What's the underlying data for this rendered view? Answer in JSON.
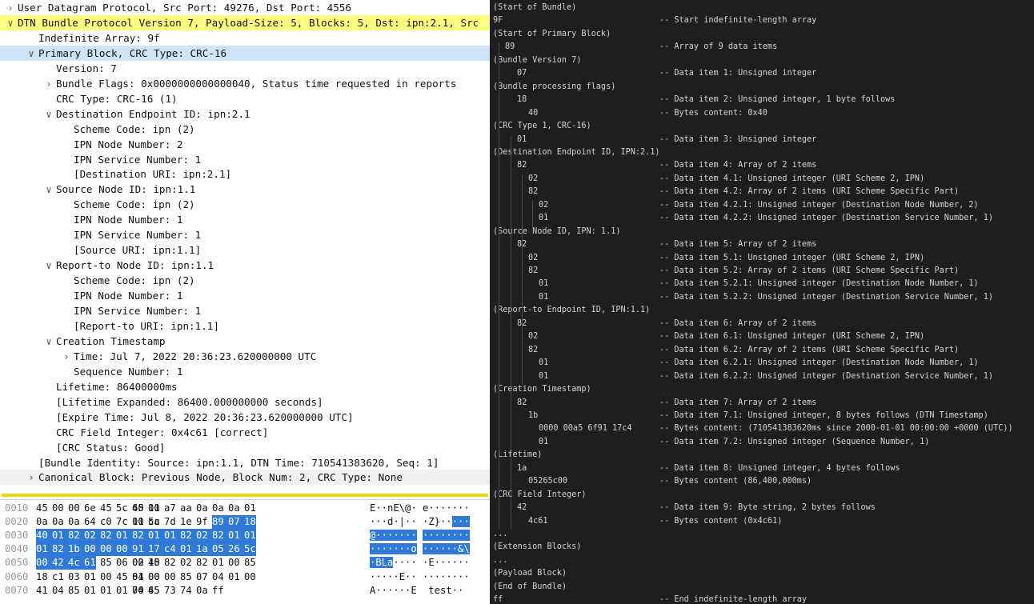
{
  "tree": [
    {
      "text": "User Datagram Protocol, Src Port: 49276, Dst Port: 4556",
      "indent": 0,
      "toggle": "right",
      "hl": ""
    },
    {
      "text": "DTN Bundle Protocol Version 7, Payload-Size: 5, Blocks: 5, Dst: ipn:2.1, Src",
      "indent": 0,
      "toggle": "down",
      "hl": "yellow"
    },
    {
      "text": "Indefinite Array: 9f",
      "indent": 1,
      "toggle": "",
      "hl": ""
    },
    {
      "text": "Primary Block, CRC Type: CRC-16",
      "indent": 1,
      "toggle": "down",
      "hl": "blue"
    },
    {
      "text": "Version: 7",
      "indent": 2,
      "toggle": "",
      "hl": ""
    },
    {
      "text": "Bundle Flags: 0x0000000000000040, Status time requested in reports",
      "indent": 2,
      "toggle": "right",
      "hl": ""
    },
    {
      "text": "CRC Type: CRC-16 (1)",
      "indent": 2,
      "toggle": "",
      "hl": ""
    },
    {
      "text": "Destination Endpoint ID: ipn:2.1",
      "indent": 2,
      "toggle": "down",
      "hl": ""
    },
    {
      "text": "Scheme Code: ipn (2)",
      "indent": 3,
      "toggle": "",
      "hl": ""
    },
    {
      "text": "IPN Node Number: 2",
      "indent": 3,
      "toggle": "",
      "hl": ""
    },
    {
      "text": "IPN Service Number: 1",
      "indent": 3,
      "toggle": "",
      "hl": ""
    },
    {
      "text": "[Destination URI: ipn:2.1]",
      "indent": 3,
      "toggle": "",
      "hl": ""
    },
    {
      "text": "Source Node ID: ipn:1.1",
      "indent": 2,
      "toggle": "down",
      "hl": ""
    },
    {
      "text": "Scheme Code: ipn (2)",
      "indent": 3,
      "toggle": "",
      "hl": ""
    },
    {
      "text": "IPN Node Number: 1",
      "indent": 3,
      "toggle": "",
      "hl": ""
    },
    {
      "text": "IPN Service Number: 1",
      "indent": 3,
      "toggle": "",
      "hl": ""
    },
    {
      "text": "[Source URI: ipn:1.1]",
      "indent": 3,
      "toggle": "",
      "hl": ""
    },
    {
      "text": "Report-to Node ID: ipn:1.1",
      "indent": 2,
      "toggle": "down",
      "hl": ""
    },
    {
      "text": "Scheme Code: ipn (2)",
      "indent": 3,
      "toggle": "",
      "hl": ""
    },
    {
      "text": "IPN Node Number: 1",
      "indent": 3,
      "toggle": "",
      "hl": ""
    },
    {
      "text": "IPN Service Number: 1",
      "indent": 3,
      "toggle": "",
      "hl": ""
    },
    {
      "text": "[Report-to URI: ipn:1.1]",
      "indent": 3,
      "toggle": "",
      "hl": ""
    },
    {
      "text": "Creation Timestamp",
      "indent": 2,
      "toggle": "down",
      "hl": ""
    },
    {
      "text": "Time: Jul  7, 2022 20:36:23.620000000 UTC",
      "indent": 3,
      "toggle": "right",
      "hl": ""
    },
    {
      "text": "Sequence Number: 1",
      "indent": 3,
      "toggle": "",
      "hl": ""
    },
    {
      "text": "Lifetime: 86400000ms",
      "indent": 2,
      "toggle": "",
      "hl": ""
    },
    {
      "text": "[Lifetime Expanded: 86400.000000000 seconds]",
      "indent": 2,
      "toggle": "",
      "hl": ""
    },
    {
      "text": "[Expire Time: Jul  8, 2022 20:36:23.620000000 UTC]",
      "indent": 2,
      "toggle": "",
      "hl": ""
    },
    {
      "text": "CRC Field Integer: 0x4c61 [correct]",
      "indent": 2,
      "toggle": "",
      "hl": ""
    },
    {
      "text": "[CRC Status: Good]",
      "indent": 2,
      "toggle": "",
      "hl": ""
    },
    {
      "text": "[Bundle Identity: Source: ipn:1.1, DTN Time: 710541383620, Seq: 1]",
      "indent": 1,
      "toggle": "",
      "hl": ""
    },
    {
      "text": "Canonical Block: Previous Node, Block Num: 2, CRC Type: None",
      "indent": 1,
      "toggle": "right",
      "hl": "grey"
    }
  ],
  "hex": [
    {
      "off": "0010",
      "b1": [
        "45",
        "00",
        "00",
        "6e",
        "45",
        "5c",
        "40",
        "00"
      ],
      "b2": [
        "65",
        "11",
        "a7",
        "aa",
        "0a",
        "0a",
        "0a",
        "01"
      ],
      "a1": "E··nE\\@·",
      "a2": "e·······"
    },
    {
      "off": "0020",
      "b1": [
        "0a",
        "0a",
        "0a",
        "64",
        "c0",
        "7c",
        "11",
        "cc"
      ],
      "b2": [
        "00",
        "5a",
        "7d",
        "1e",
        "9f",
        "89",
        "07",
        "18"
      ],
      "a1": "···d·|··",
      "a2": "·Z}·····"
    },
    {
      "off": "0030",
      "b1": [
        "40",
        "01",
        "82",
        "02",
        "82",
        "01",
        "82",
        "02"
      ],
      "b2": [
        "82",
        "01",
        "01",
        "82",
        "02",
        "82",
        "01",
        "01"
      ],
      "a1": "@·······",
      "a2": "········"
    },
    {
      "off": "0040",
      "b1": [
        "01",
        "82",
        "1b",
        "00",
        "00",
        "00",
        "a5",
        "6f"
      ],
      "b2": [
        "91",
        "17",
        "c4",
        "01",
        "1a",
        "05",
        "26",
        "5c"
      ],
      "a1": "·······o",
      "a2": "······&\\"
    },
    {
      "off": "0050",
      "b1": [
        "00",
        "42",
        "4c",
        "61",
        "85",
        "06",
        "02",
        "10"
      ],
      "b2": [
        "00",
        "45",
        "82",
        "02",
        "82",
        "01",
        "00",
        "85"
      ],
      "a1": "·BLa····",
      "a2": "·E······"
    },
    {
      "off": "0060",
      "b1": [
        "18",
        "c1",
        "03",
        "01",
        "00",
        "45",
        "84",
        "00"
      ],
      "b2": [
        "01",
        "00",
        "00",
        "85",
        "07",
        "04",
        "01",
        "00"
      ],
      "a1": "·····E··",
      "a2": "········"
    },
    {
      "off": "0070",
      "b1": [
        "41",
        "04",
        "85",
        "01",
        "01",
        "01",
        "00",
        "45"
      ],
      "b2": [
        "74",
        "65",
        "73",
        "74",
        "0a",
        "ff"
      ],
      "a1": "A······E",
      "a2": " test··"
    }
  ],
  "cbor": [
    {
      "code": "(Start of Bundle)",
      "indent": 0,
      "comment": ""
    },
    {
      "code": "9F",
      "indent": 0,
      "comment": "-- Start indefinite-length array"
    },
    {
      "code": "(Start of Primary Block)",
      "indent": 0,
      "comment": ""
    },
    {
      "code": "89",
      "indent": 1,
      "comment": "-- Array of 9 data items"
    },
    {
      "code": "(Bundle Version 7)",
      "indent": 0,
      "comment": ""
    },
    {
      "code": "07",
      "indent": 2,
      "comment": "-- Data item 1: Unsigned integer"
    },
    {
      "code": "(Bundle processing flags)",
      "indent": 0,
      "comment": ""
    },
    {
      "code": "18",
      "indent": 2,
      "comment": "-- Data item 2: Unsigned integer, 1 byte follows"
    },
    {
      "code": "40",
      "indent": 3,
      "comment": "-- Bytes content: 0x40"
    },
    {
      "code": "(CRC Type 1, CRC-16)",
      "indent": 0,
      "comment": ""
    },
    {
      "code": "01",
      "indent": 2,
      "comment": "-- Data item 3: Unsigned integer"
    },
    {
      "code": "(Destination Endpoint ID, IPN:2.1)",
      "indent": 0,
      "comment": ""
    },
    {
      "code": "82",
      "indent": 2,
      "comment": "-- Data item 4: Array of 2 items"
    },
    {
      "code": "02",
      "indent": 3,
      "comment": "-- Data item 4.1: Unsigned integer (URI Scheme 2, IPN)"
    },
    {
      "code": "82",
      "indent": 3,
      "comment": "-- Data item 4.2: Array of 2 items (URI Scheme Specific Part)"
    },
    {
      "code": "02",
      "indent": 4,
      "comment": "-- Data item 4.2.1: Unsigned integer (Destination Node Number, 2)"
    },
    {
      "code": "01",
      "indent": 4,
      "comment": "-- Data item 4.2.2: Unsigned integer (Destination Service Number, 1)"
    },
    {
      "code": "(Source Node ID, IPN: 1.1)",
      "indent": 0,
      "comment": ""
    },
    {
      "code": "82",
      "indent": 2,
      "comment": "-- Data item 5: Array of 2 items"
    },
    {
      "code": "02",
      "indent": 3,
      "comment": "-- Data item 5.1: Unsigned integer (URI Scheme 2, IPN)"
    },
    {
      "code": "82",
      "indent": 3,
      "comment": "-- Data item 5.2: Array of 2 items (URI Scheme Specific Part)"
    },
    {
      "code": "01",
      "indent": 4,
      "comment": "-- Data item 5.2.1: Unsigned integer (Destination Node Number, 1)"
    },
    {
      "code": "01",
      "indent": 4,
      "comment": "-- Data item 5.2.2: Unsigned integer (Destination Service Number, 1)"
    },
    {
      "code": "(Report-to Endpoint ID, IPN:1.1)",
      "indent": 0,
      "comment": ""
    },
    {
      "code": "82",
      "indent": 2,
      "comment": "-- Data item 6: Array of 2 items"
    },
    {
      "code": "02",
      "indent": 3,
      "comment": "-- Data item 6.1: Unsigned integer (URI Scheme 2, IPN)"
    },
    {
      "code": "82",
      "indent": 3,
      "comment": "-- Data item 6.2: Array of 2 items (URI Scheme Specific Part)"
    },
    {
      "code": "01",
      "indent": 4,
      "comment": "-- Data item 6.2.1: Unsigned integer (Destination Node Number, 1)"
    },
    {
      "code": "01",
      "indent": 4,
      "comment": "-- Data item 6.2.2: Unsigned integer (Destination Service Number, 1)"
    },
    {
      "code": "(Creation Timestamp)",
      "indent": 0,
      "comment": ""
    },
    {
      "code": "82",
      "indent": 2,
      "comment": "-- Data item 7: Array of 2 items"
    },
    {
      "code": "1b",
      "indent": 3,
      "comment": "-- Data item 7.1: Unsigned integer, 8 bytes follows (DTN Timestamp)"
    },
    {
      "code": "0000 00a5 6f91 17c4",
      "indent": 4,
      "comment": "-- Bytes content: (710541383620ms since 2000-01-01 00:00:00 +0000 (UTC))"
    },
    {
      "code": "01",
      "indent": 4,
      "comment": "-- Data item 7.2: Unsigned integer (Sequence Number, 1)"
    },
    {
      "code": "(Lifetime)",
      "indent": 0,
      "comment": ""
    },
    {
      "code": "1a",
      "indent": 2,
      "comment": "-- Data item 8: Unsigned integer, 4 bytes follows"
    },
    {
      "code": "05265c00",
      "indent": 3,
      "comment": "-- Bytes content (86,400,000ms)"
    },
    {
      "code": "(CRC Field Integer)",
      "indent": 0,
      "comment": ""
    },
    {
      "code": "42",
      "indent": 2,
      "comment": "-- Data item 9: Byte string, 2 bytes follows"
    },
    {
      "code": "4c61",
      "indent": 3,
      "comment": "-- Bytes content (0x4c61)"
    },
    {
      "code": "...",
      "indent": 0,
      "comment": ""
    },
    {
      "code": "(Extension Blocks)",
      "indent": 0,
      "comment": ""
    },
    {
      "code": "...",
      "indent": 0,
      "comment": ""
    },
    {
      "code": "(Payload Block)",
      "indent": 0,
      "comment": ""
    },
    {
      "code": "(End of Bundle)",
      "indent": 0,
      "comment": ""
    },
    {
      "code": "ff",
      "indent": 0,
      "comment": "-- End indefinite-length array"
    }
  ],
  "colors": {
    "selection": "#2f7ad6",
    "highlight_yellow": "#ffff80",
    "highlight_blue": "#cfe4f7",
    "terminal_bg": "#1e1e1e"
  },
  "icons": {
    "collapsed": "chevron-right-icon",
    "expanded": "chevron-down-icon"
  }
}
